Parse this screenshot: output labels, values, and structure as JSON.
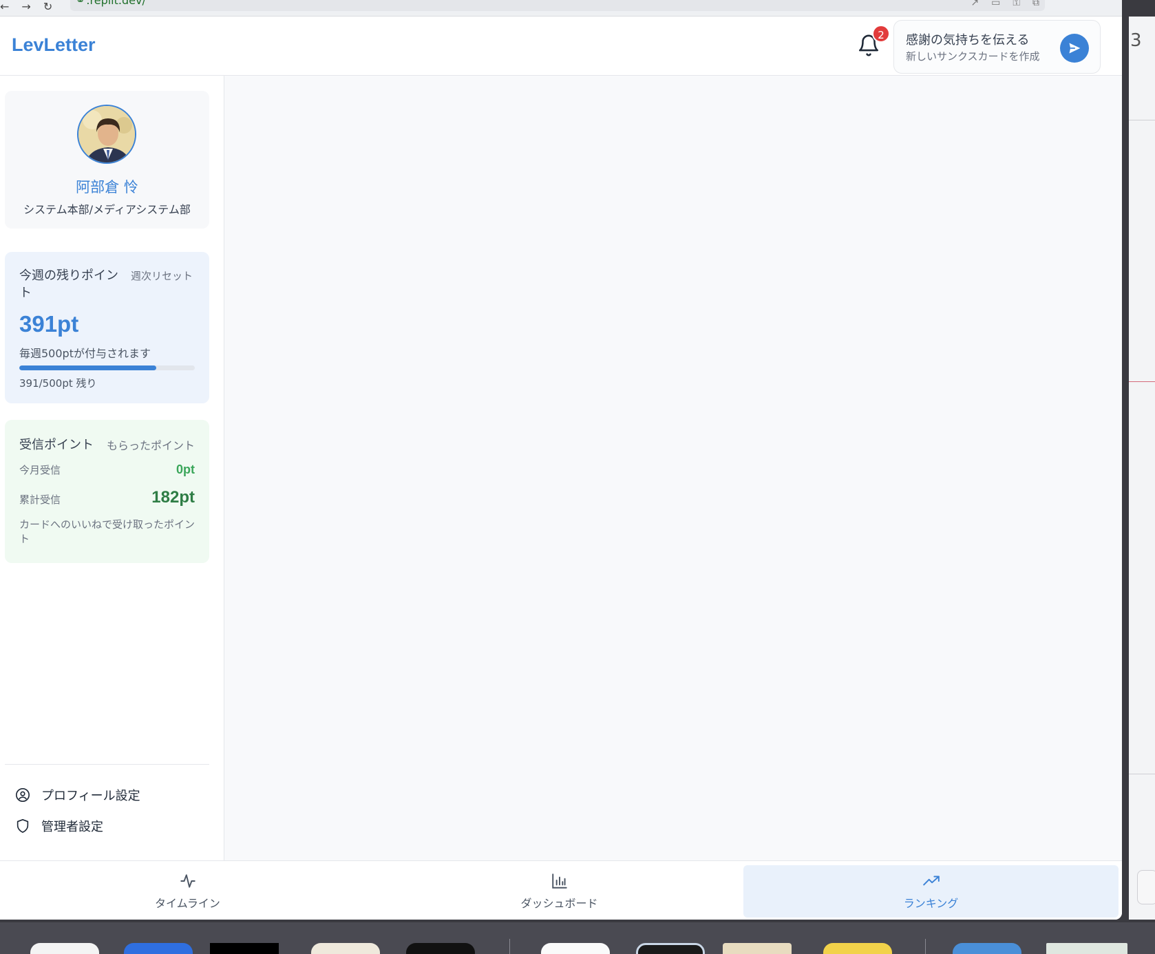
{
  "browser": {
    "url": ".replit.dev/"
  },
  "header": {
    "logo": "LevLetter",
    "notification_count": "2",
    "cta_title": "感謝の気持ちを伝える",
    "cta_subtitle": "新しいサンクスカードを作成"
  },
  "profile": {
    "name": "阿部倉 怜",
    "department": "システム本部/メディアシステム部"
  },
  "weekly_points": {
    "title": "今週の残りポイント",
    "reset_label": "週次リセット",
    "value": "391pt",
    "note": "毎週500ptが付与されます",
    "remaining_fraction": 0.782,
    "progress_label": "391/500pt 残り"
  },
  "received_points": {
    "title": "受信ポイント",
    "subtitle": "もらったポイント",
    "month_label": "今月受信",
    "month_value": "0pt",
    "total_label": "累計受信",
    "total_value": "182pt",
    "note": "カードへのいいねで受け取ったポイント"
  },
  "sidebar_menu": [
    {
      "label": "プロフィール設定",
      "icon": "user-circle-icon"
    },
    {
      "label": "管理者設定",
      "icon": "shield-icon"
    }
  ],
  "bottom_nav": [
    {
      "label": "タイムライン",
      "icon": "activity-icon",
      "active": false
    },
    {
      "label": "ダッシュボード",
      "icon": "bar-chart-icon",
      "active": false
    },
    {
      "label": "ランキング",
      "icon": "trending-up-icon",
      "active": true
    }
  ],
  "right_peek": {
    "number": "3"
  },
  "colors": {
    "accent": "#3b82d6",
    "badge": "#e23b3b",
    "points_bg": "#edf3fc",
    "received_bg": "#f0faf2",
    "received_value": "#2e7d45"
  }
}
